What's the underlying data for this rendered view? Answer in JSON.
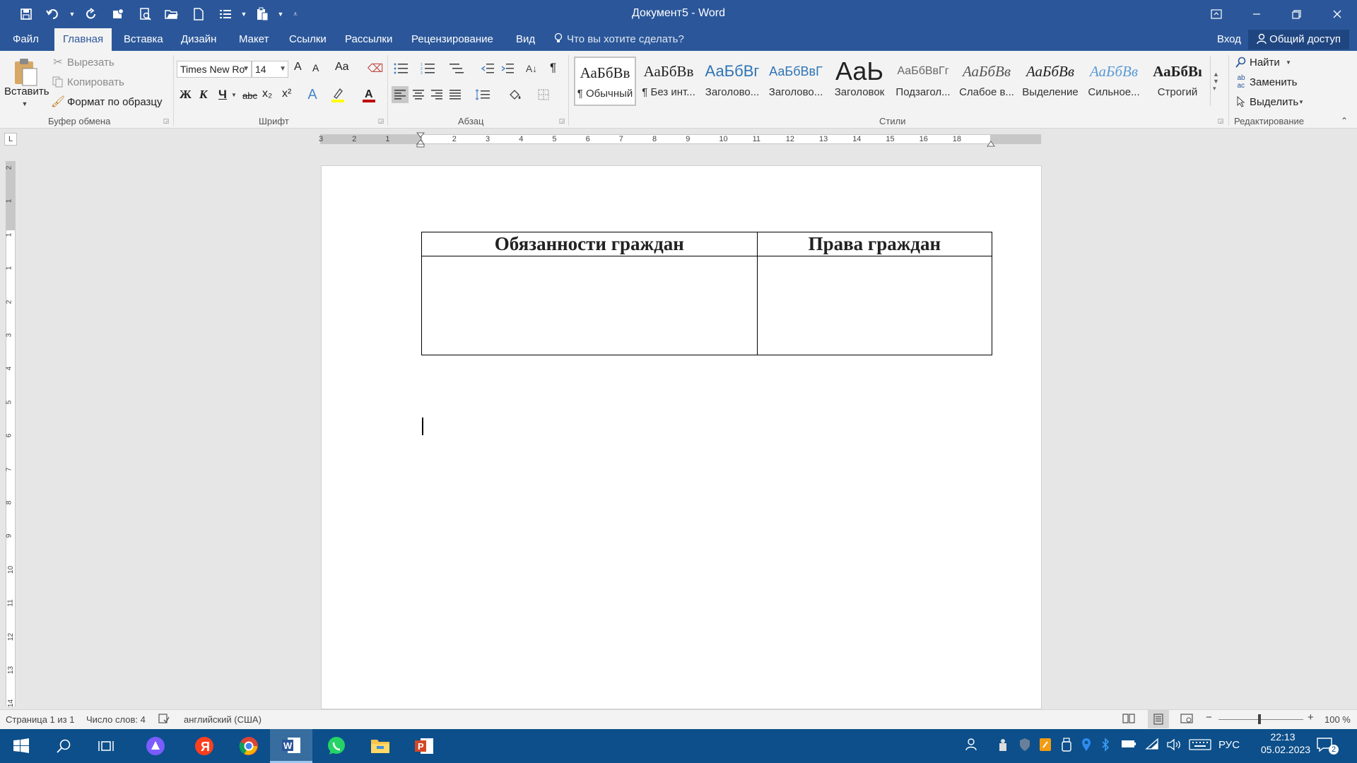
{
  "app": {
    "title": "Документ5 - Word",
    "colors": {
      "accent": "#2b579a",
      "taskbar": "#0c4f8a"
    }
  },
  "qat": {
    "icons": [
      "save-icon",
      "undo-icon",
      "redo-icon",
      "touch-mode-icon",
      "print-preview-icon",
      "open-icon",
      "new-doc-icon",
      "list-icon",
      "paste-icon",
      "customize-icon"
    ]
  },
  "tabs": [
    {
      "label": "Файл"
    },
    {
      "label": "Главная"
    },
    {
      "label": "Вставка"
    },
    {
      "label": "Дизайн"
    },
    {
      "label": "Макет"
    },
    {
      "label": "Ссылки"
    },
    {
      "label": "Рассылки"
    },
    {
      "label": "Рецензирование"
    },
    {
      "label": "Вид"
    }
  ],
  "tell_me": "Что вы хотите сделать?",
  "signin": "Вход",
  "share": "Общий доступ",
  "clipboard": {
    "paste": "Вставить",
    "cut": "Вырезать",
    "copy": "Копировать",
    "format_painter": "Формат по образцу",
    "group": "Буфер обмена"
  },
  "font": {
    "name": "Times New Ro",
    "size": "14",
    "bold": "Ж",
    "italic": "К",
    "underline": "Ч",
    "strike": "abc",
    "sub": "x₂",
    "sup": "x²",
    "grow": "A",
    "shrink": "A",
    "case": "Aa",
    "group": "Шрифт"
  },
  "paragraph": {
    "group": "Абзац",
    "pilcrow": "¶"
  },
  "styles": {
    "group": "Стили",
    "items": [
      {
        "sample": "АаБбВв",
        "name": "¶ Обычный"
      },
      {
        "sample": "АаБбВв",
        "name": "¶ Без инт..."
      },
      {
        "sample": "АаБбВг",
        "name": "Заголово..."
      },
      {
        "sample": "АаБбВвГ",
        "name": "Заголово..."
      },
      {
        "sample": "АаЬ",
        "name": "Заголовок"
      },
      {
        "sample": "АаБбВвГг",
        "name": "Подзагол..."
      },
      {
        "sample": "АаБбВв",
        "name": "Слабое в..."
      },
      {
        "sample": "АаБбВв",
        "name": "Выделение"
      },
      {
        "sample": "АаБбВв",
        "name": "Сильное..."
      },
      {
        "sample": "АаБбВı",
        "name": "Строгий"
      }
    ]
  },
  "editing": {
    "find": "Найти",
    "replace": "Заменить",
    "select": "Выделить",
    "group": "Редактирование"
  },
  "ruler": {
    "h_labels": [
      "3",
      "2",
      "1",
      "1",
      "2",
      "3",
      "4",
      "5",
      "6",
      "7",
      "8",
      "9",
      "10",
      "11",
      "12",
      "13",
      "14",
      "15",
      "16",
      "18"
    ],
    "v_labels": [
      "2",
      "1",
      "1",
      "1",
      "2",
      "3",
      "4",
      "5",
      "6",
      "7",
      "8",
      "9",
      "10",
      "11",
      "12",
      "13",
      "14"
    ],
    "corner": "L"
  },
  "document": {
    "table": {
      "headers": [
        "Обязанности граждан",
        "Права граждан"
      ]
    }
  },
  "status": {
    "page": "Страница 1 из 1",
    "words": "Число слов: 4",
    "language": "английский (США)",
    "zoom": "100 %"
  },
  "taskbar": {
    "apps": [
      "windows-start-icon",
      "search-icon",
      "task-view-icon",
      "alice-icon",
      "yandex-icon",
      "chrome-icon",
      "word-icon",
      "whatsapp-icon",
      "explorer-icon",
      "powerpoint-icon"
    ],
    "lang": "РУС",
    "time": "22:13",
    "date": "05.02.2023",
    "notif_count": "2"
  }
}
